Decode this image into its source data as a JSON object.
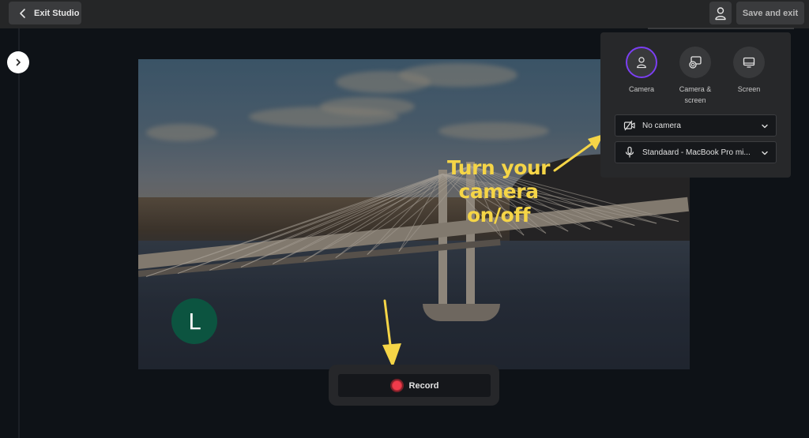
{
  "topbar": {
    "exit_label": "Exit Studio",
    "save_label": "Save and exit",
    "profile_icon": "person-icon"
  },
  "sidebar": {
    "expand_icon": "chevron-right-icon"
  },
  "preview": {
    "scene": "cable-stayed bridge over river at sunset",
    "user_initial": "L",
    "user_avatar_color": "#0c5440"
  },
  "annotations": {
    "camera_hint_line1": "Turn your",
    "camera_hint_line2": "camera on/off",
    "color": "#f5d547"
  },
  "record": {
    "label": "Record",
    "dot_color": "#ef3b4b"
  },
  "panel": {
    "modes": [
      {
        "label": "Camera",
        "icon": "person-icon",
        "active": true
      },
      {
        "label": "Camera & screen",
        "icon": "camera-screen-icon",
        "active": false
      },
      {
        "label": "Screen",
        "icon": "monitor-icon",
        "active": false
      }
    ],
    "active_color": "#7b3ff2",
    "camera_select": {
      "value": "No camera",
      "icon": "camera-off-icon"
    },
    "mic_select": {
      "value": "Standaard - MacBook Pro mi...",
      "icon": "microphone-icon"
    }
  }
}
